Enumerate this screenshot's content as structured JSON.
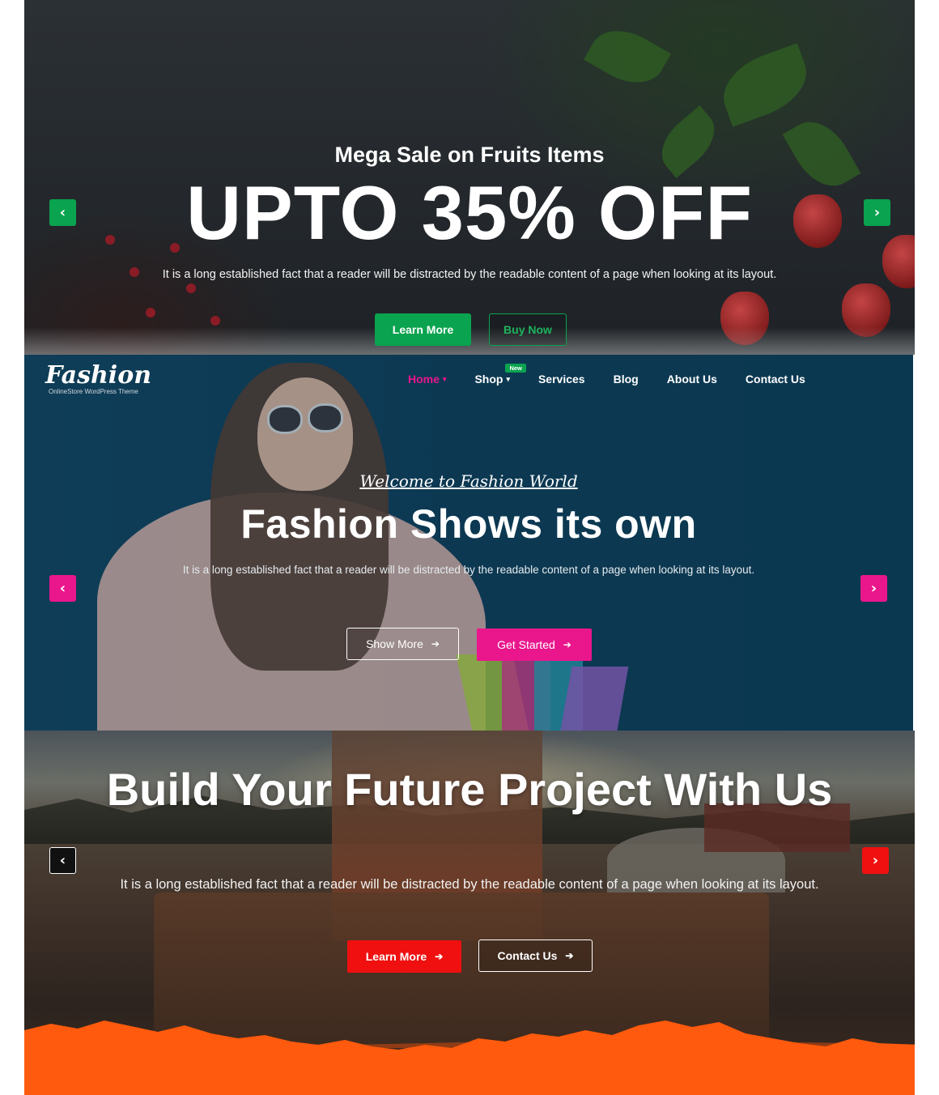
{
  "fruit_slide": {
    "subtitle": "Mega Sale on Fruits Items",
    "title": "UPTO 35% OFF",
    "description": "It is a long established fact that a reader will be distracted by the readable content of a page when looking at its layout.",
    "primary_button": "Learn More",
    "secondary_button": "Buy Now",
    "prev_arrow": "‹",
    "next_arrow": "›",
    "accent_color": "#0aa34f"
  },
  "fashion_slide": {
    "logo": {
      "word": "Fashion",
      "tagline": "OnlineStore WordPress Theme"
    },
    "nav": {
      "items": [
        {
          "label": "Home",
          "active": true,
          "dropdown": true
        },
        {
          "label": "Shop",
          "active": false,
          "dropdown": true,
          "badge": "New"
        },
        {
          "label": "Services",
          "active": false,
          "dropdown": false
        },
        {
          "label": "Blog",
          "active": false,
          "dropdown": false
        },
        {
          "label": "About Us",
          "active": false,
          "dropdown": false
        },
        {
          "label": "Contact Us",
          "active": false,
          "dropdown": false
        }
      ]
    },
    "kicker": "Welcome to Fashion World",
    "title": "Fashion Shows its own",
    "description": "It is a long established fact that a reader will be distracted by the readable content of a page when looking at its layout.",
    "primary_button": "Show More",
    "secondary_button": "Get Started",
    "button_arrow": "➔",
    "prev_arrow": "‹",
    "next_arrow": "›",
    "accent_color": "#e9168c"
  },
  "build_slide": {
    "title": "Build Your Future Project With Us",
    "description": "It is a long established fact that a reader will be distracted by the readable content of a page when looking at its layout.",
    "primary_button": "Learn More",
    "secondary_button": "Contact Us",
    "button_arrow": "➔",
    "prev_arrow": "‹",
    "next_arrow": "›",
    "accent_color": "#f01010",
    "edge_color": "#ff5a0d"
  }
}
